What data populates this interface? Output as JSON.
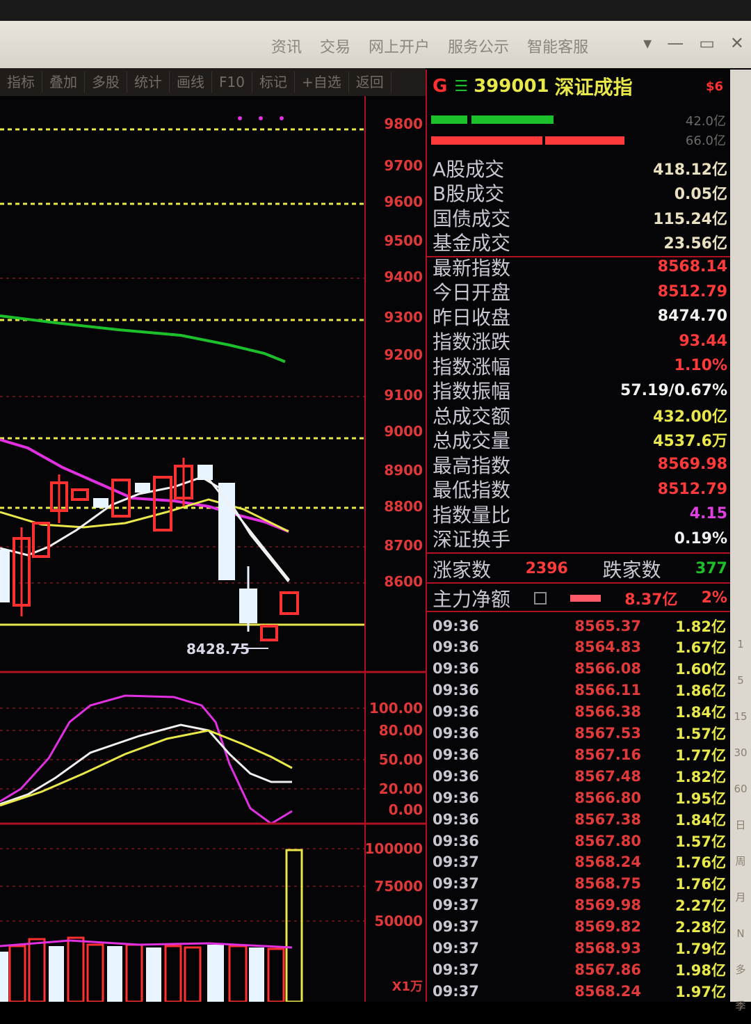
{
  "titlebar": {
    "menu": [
      "资讯",
      "交易",
      "网上开户",
      "服务公示",
      "智能客服"
    ],
    "controls": [
      "▾",
      "—",
      "▭",
      "✕"
    ]
  },
  "toolbar": [
    "指标",
    "叠加",
    "多股",
    "统计",
    "画线",
    "F10",
    "标记",
    "+自选",
    "返回"
  ],
  "chart": {
    "price_ticks": [
      "9800",
      "9700",
      "9600",
      "9500",
      "9400",
      "9300",
      "9200",
      "9100",
      "9000",
      "8900",
      "8800",
      "8700",
      "8600"
    ],
    "low_marker": "8428.75",
    "kdj_ticks": [
      "100.00",
      "80.00",
      "50.00",
      "20.00",
      "0.00"
    ],
    "vol_ticks": [
      "100000",
      "75000",
      "50000"
    ],
    "vol_unit": "X1万",
    "colors": {
      "up": "#ff3030",
      "down": "#e8f4ff",
      "ma_green": "#1cc02a",
      "ma_magenta": "#e030e0",
      "ma_yellow": "#e8e84a",
      "ma_white": "#f0f0f0"
    }
  },
  "panel": {
    "header": {
      "code_prefix": "G",
      "code": "399001",
      "name": "深证成指",
      "badge": "$6"
    },
    "bars_right": [
      "42.0亿",
      "66.0亿"
    ],
    "stats": [
      {
        "label": "A股成交",
        "value": "418.12亿",
        "color": "#e8e0c0"
      },
      {
        "label": "B股成交",
        "value": "0.05亿",
        "color": "#e8e0c0"
      },
      {
        "label": "国债成交",
        "value": "115.24亿",
        "color": "#e8e0c0"
      },
      {
        "label": "基金成交",
        "value": "23.56亿",
        "color": "#e8e0c0"
      },
      {
        "label": "最新指数",
        "value": "8568.14",
        "color": "#ff3a3a"
      },
      {
        "label": "今日开盘",
        "value": "8512.79",
        "color": "#ff3a3a"
      },
      {
        "label": "昨日收盘",
        "value": "8474.70",
        "color": "#f0f0f0"
      },
      {
        "label": "指数涨跌",
        "value": "93.44",
        "color": "#ff3a3a"
      },
      {
        "label": "指数涨幅",
        "value": "1.10%",
        "color": "#ff3a3a"
      },
      {
        "label": "指数振幅",
        "value": "57.19/0.67%",
        "color": "#f0f0f0"
      },
      {
        "label": "总成交额",
        "value": "432.00亿",
        "color": "#e8e84a"
      },
      {
        "label": "总成交量",
        "value": "4537.6万",
        "color": "#e8e84a"
      },
      {
        "label": "最高指数",
        "value": "8569.98",
        "color": "#ff3a3a"
      },
      {
        "label": "最低指数",
        "value": "8512.79",
        "color": "#ff3a3a"
      },
      {
        "label": "指数量比",
        "value": "4.15",
        "color": "#e040e0"
      },
      {
        "label": "深证换手",
        "value": "0.19%",
        "color": "#f0f0f0"
      }
    ],
    "breadth": {
      "up_label": "涨家数",
      "up_value": "2396",
      "down_label": "跌家数",
      "down_value": "377"
    },
    "net_flow": {
      "label": "主力净额",
      "value": "8.37亿",
      "pct": "2%"
    },
    "ticks": [
      {
        "time": "09:36",
        "price": "8565.37",
        "amount": "1.82亿"
      },
      {
        "time": "09:36",
        "price": "8564.83",
        "amount": "1.67亿"
      },
      {
        "time": "09:36",
        "price": "8566.08",
        "amount": "1.60亿"
      },
      {
        "time": "09:36",
        "price": "8566.11",
        "amount": "1.86亿"
      },
      {
        "time": "09:36",
        "price": "8566.38",
        "amount": "1.84亿"
      },
      {
        "time": "09:36",
        "price": "8567.53",
        "amount": "1.57亿"
      },
      {
        "time": "09:36",
        "price": "8567.16",
        "amount": "1.77亿"
      },
      {
        "time": "09:36",
        "price": "8567.48",
        "amount": "1.82亿"
      },
      {
        "time": "09:36",
        "price": "8566.80",
        "amount": "1.95亿"
      },
      {
        "time": "09:36",
        "price": "8567.38",
        "amount": "1.84亿"
      },
      {
        "time": "09:36",
        "price": "8567.80",
        "amount": "1.57亿"
      },
      {
        "time": "09:37",
        "price": "8568.24",
        "amount": "1.76亿"
      },
      {
        "time": "09:37",
        "price": "8568.75",
        "amount": "1.76亿"
      },
      {
        "time": "09:37",
        "price": "8569.98",
        "amount": "2.27亿"
      },
      {
        "time": "09:37",
        "price": "8569.82",
        "amount": "2.28亿"
      },
      {
        "time": "09:37",
        "price": "8568.93",
        "amount": "1.79亿"
      },
      {
        "time": "09:37",
        "price": "8567.86",
        "amount": "1.98亿"
      },
      {
        "time": "09:37",
        "price": "8568.24",
        "amount": "1.97亿"
      }
    ]
  },
  "sidebar": [
    "1",
    "5",
    "15",
    "30",
    "60",
    "日",
    "周",
    "月",
    "N",
    "多",
    "季"
  ]
}
